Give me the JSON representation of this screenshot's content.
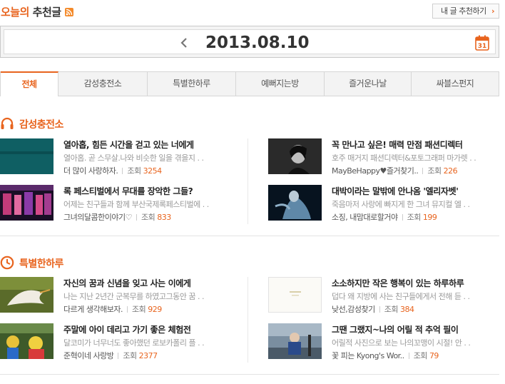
{
  "header": {
    "title_accent": "오늘의",
    "title_rest": "추천글",
    "recommend_button": "내 글 추천하기",
    "recommend_chevron": "›"
  },
  "date": {
    "prev_arrow": "‹",
    "value": "2013.08.10",
    "calendar_day": "31"
  },
  "tabs": [
    {
      "label": "전체",
      "active": true
    },
    {
      "label": "감성충전소",
      "active": false
    },
    {
      "label": "특별한하루",
      "active": false
    },
    {
      "label": "예뻐지는방",
      "active": false
    },
    {
      "label": "즐거운나날",
      "active": false
    },
    {
      "label": "싸블스펀지",
      "active": false
    }
  ],
  "views_label": "조회",
  "sections": [
    {
      "title": "감성충전소",
      "icon": "headphones-icon",
      "items": [
        {
          "title": "열아홉, 힘든 시간을 걷고 있는 너에게",
          "desc": "열아홉. 곧 스무살.나와 비슷한 일을 겪을지 . .",
          "author": "더 많이 사랑하자.",
          "views": "3254",
          "thumb": "thumb-teal"
        },
        {
          "title": "꼭 만나고 싶은! 매력 만점 패션디렉터",
          "desc": "호주 매거지 패션디렉터&포토그래퍼 마가렛 . .",
          "author": "MayBeHappy♥즐거찾기..",
          "views": "226",
          "thumb": "thumb-portrait"
        },
        {
          "title": "록 페스티벌에서 무대를 장악한 그들?",
          "desc": "어제는 친구들과 함께 부산국제록페스티벌에 . .",
          "author": "그녀의달콤한이야기♡",
          "views": "833",
          "thumb": "thumb-concert"
        },
        {
          "title": "대박이라는 말밖에 안나옴 '엘리자벳'",
          "desc": "죽음마저 사랑에 빠지게 한 그녀 뮤지컬 엘 . .",
          "author": "소징, 내맘대로할거야",
          "views": "199",
          "thumb": "thumb-musical"
        }
      ]
    },
    {
      "title": "특별한하루",
      "icon": "clock-icon",
      "items": [
        {
          "title": "자신의 꿈과 신념을 잊고 사는 이에게",
          "desc": "나는 지난 2년간 군복무를 하였고그동안 꿈 . .",
          "author": "다르게 생각해보자.",
          "views": "929",
          "thumb": "thumb-dove"
        },
        {
          "title": "소소하지만 작은 행복이 있는 하루하루",
          "desc": "덥다 왜 지방에 사는 친구들에게서 전해 듣 . .",
          "author": "낮선,감성찾기",
          "views": "384",
          "thumb": "thumb-card"
        },
        {
          "title": "주말에 아이 데리고 가기 좋은 체험전",
          "desc": "달코미가 너무너도 좋아했던 로보카폴리 플 . .",
          "author": "준혁이네 사랑방",
          "views": "2377",
          "thumb": "thumb-kids"
        },
        {
          "title": "그땐 그랬지~나의 어릴 적 추억 필이",
          "desc": "어릴적 사진으로 보는 나의꼬맹이 시절! 안 . .",
          "author": "꽃 피는 Kyong's Wor..",
          "views": "79",
          "thumb": "thumb-child"
        }
      ]
    }
  ],
  "colors": {
    "accent": "#e8641e",
    "muted": "#9a9a9a",
    "border": "#d6d6d6"
  }
}
